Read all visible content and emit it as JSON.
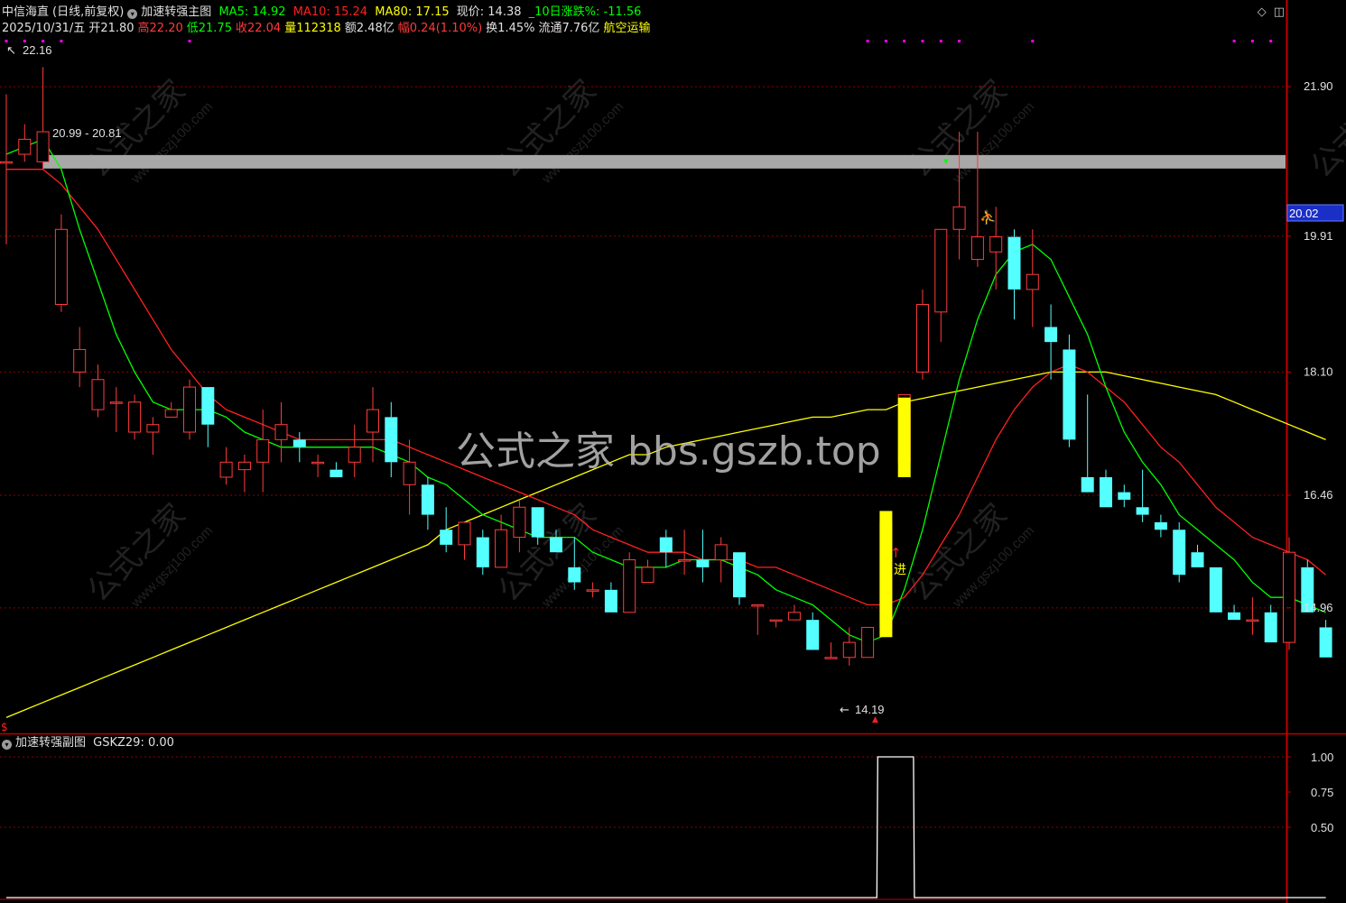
{
  "header": {
    "stock_name": "中信海直",
    "period_mode": "(日线,前复权)",
    "indicator_name": "加速转强主图",
    "ma5": "MA5: 14.92",
    "ma10": "MA10: 15.24",
    "ma80": "MA80: 17.15",
    "current_price": "现价: 14.38",
    "change10": "_10日涨跌%: -11.56",
    "date": "2025/10/31/五",
    "open": "开21.80",
    "high": "高22.20",
    "low": "低21.75",
    "close": "收22.04",
    "volume": "量112318",
    "amount": "额2.48亿",
    "amplitude": "幅0.24(1.10%)",
    "turnover": "换1.45%",
    "float_cap": "流通7.76亿",
    "sector": "航空运输"
  },
  "sub_header": {
    "indicator_name": "加速转强副图",
    "value": "GSKZ29: 0.00"
  },
  "annotations": {
    "high_marker": "22.16",
    "low_marker": "14.19",
    "band_label": "20.99 - 20.81",
    "entry_label": "进",
    "price_tag": "20.02"
  },
  "watermark": {
    "main": "公式之家 bbs.gszb.top",
    "tile_cn": "公式之家",
    "tile_url": "www.gszj100.com"
  },
  "colors": {
    "up": "#ff3b3b",
    "down": "#54ffff",
    "ma5": "#00ff00",
    "ma10": "#ff2020",
    "ma80": "#ffff00",
    "signal": "#ffff00",
    "band": "#a8a8a8",
    "axis": "#c00000",
    "tick_text": "#e0e0e0"
  },
  "chart_data": [
    {
      "type": "candlestick",
      "title": "加速转强主图",
      "y_ticks": [
        "21.90",
        "19.91",
        "18.10",
        "16.46",
        "14.96"
      ],
      "ylim": [
        13.3,
        22.55
      ],
      "ohlc": [
        [
          20.9,
          21.8,
          19.8,
          20.9
        ],
        [
          21.0,
          21.4,
          20.9,
          21.2
        ],
        [
          20.9,
          22.16,
          20.8,
          21.3
        ],
        [
          19.0,
          20.2,
          18.9,
          20.0
        ],
        [
          18.1,
          18.7,
          17.9,
          18.4
        ],
        [
          17.6,
          18.2,
          17.5,
          18.0
        ],
        [
          17.7,
          17.9,
          17.3,
          17.7
        ],
        [
          17.3,
          17.8,
          17.2,
          17.7
        ],
        [
          17.3,
          17.5,
          17.0,
          17.4
        ],
        [
          17.5,
          17.7,
          17.5,
          17.6
        ],
        [
          17.3,
          18.0,
          17.2,
          17.9
        ],
        [
          17.9,
          17.9,
          17.1,
          17.4
        ],
        [
          16.7,
          17.1,
          16.6,
          16.9
        ],
        [
          16.8,
          17.0,
          16.5,
          16.9
        ],
        [
          16.9,
          17.6,
          16.5,
          17.2
        ],
        [
          17.2,
          17.7,
          16.9,
          17.4
        ],
        [
          17.2,
          17.3,
          16.9,
          17.1
        ],
        [
          16.9,
          17.0,
          16.7,
          16.9
        ],
        [
          16.8,
          16.9,
          16.7,
          16.7
        ],
        [
          16.9,
          17.4,
          16.7,
          17.1
        ],
        [
          17.3,
          17.9,
          16.9,
          17.6
        ],
        [
          17.5,
          17.7,
          16.7,
          16.9
        ],
        [
          16.6,
          17.2,
          16.2,
          16.9
        ],
        [
          16.6,
          16.7,
          16.0,
          16.2
        ],
        [
          16.0,
          16.3,
          15.7,
          15.8
        ],
        [
          15.8,
          16.1,
          15.6,
          16.1
        ],
        [
          15.9,
          16.0,
          15.4,
          15.5
        ],
        [
          15.5,
          16.2,
          15.5,
          16.0
        ],
        [
          15.9,
          16.4,
          15.7,
          16.3
        ],
        [
          16.3,
          16.3,
          15.8,
          15.9
        ],
        [
          15.9,
          16.0,
          15.7,
          15.7
        ],
        [
          15.5,
          15.9,
          15.2,
          15.3
        ],
        [
          15.2,
          15.3,
          15.1,
          15.2
        ],
        [
          15.2,
          15.3,
          14.9,
          14.9
        ],
        [
          14.9,
          15.7,
          14.9,
          15.6
        ],
        [
          15.3,
          15.6,
          15.3,
          15.5
        ],
        [
          15.9,
          16.0,
          15.5,
          15.7
        ],
        [
          15.6,
          16.0,
          15.4,
          15.6
        ],
        [
          15.6,
          16.0,
          15.3,
          15.5
        ],
        [
          15.6,
          15.9,
          15.3,
          15.8
        ],
        [
          15.7,
          15.7,
          15.0,
          15.1
        ],
        [
          15.0,
          15.0,
          14.6,
          15.0
        ],
        [
          14.8,
          14.8,
          14.7,
          14.8
        ],
        [
          14.8,
          15.0,
          14.8,
          14.9
        ],
        [
          14.8,
          14.9,
          14.5,
          14.4
        ],
        [
          14.3,
          14.5,
          14.3,
          14.3
        ],
        [
          14.3,
          14.7,
          14.19,
          14.5
        ],
        [
          14.3,
          14.7,
          14.3,
          14.7
        ],
        [
          14.7,
          16.1,
          14.6,
          16.1
        ],
        [
          16.9,
          17.8,
          16.8,
          17.8
        ],
        [
          18.1,
          19.2,
          18.0,
          19.0
        ],
        [
          18.9,
          20.0,
          18.5,
          20.0
        ],
        [
          20.0,
          21.3,
          19.6,
          20.3
        ],
        [
          19.6,
          21.3,
          19.5,
          19.9
        ],
        [
          19.7,
          20.3,
          19.2,
          19.9
        ],
        [
          19.9,
          20.0,
          18.8,
          19.2
        ],
        [
          19.2,
          20.0,
          18.7,
          19.4
        ],
        [
          18.7,
          19.0,
          18.0,
          18.5
        ],
        [
          18.4,
          18.6,
          17.1,
          17.2
        ],
        [
          16.7,
          17.8,
          16.6,
          16.5
        ],
        [
          16.7,
          16.8,
          16.3,
          16.3
        ],
        [
          16.5,
          16.6,
          16.3,
          16.4
        ],
        [
          16.3,
          16.8,
          16.1,
          16.2
        ],
        [
          16.1,
          16.2,
          15.9,
          16.0
        ],
        [
          16.0,
          16.1,
          15.3,
          15.4
        ],
        [
          15.7,
          15.8,
          15.5,
          15.5
        ],
        [
          15.5,
          15.5,
          14.9,
          14.9
        ],
        [
          14.9,
          15.0,
          14.8,
          14.8
        ],
        [
          14.8,
          15.1,
          14.6,
          14.8
        ],
        [
          14.9,
          15.0,
          14.5,
          14.5
        ],
        [
          14.5,
          15.9,
          14.4,
          15.7
        ],
        [
          15.5,
          15.6,
          14.9,
          14.9
        ],
        [
          14.7,
          14.8,
          14.3,
          14.3
        ]
      ],
      "ma5": [
        21.0,
        21.1,
        21.2,
        20.8,
        20.0,
        19.3,
        18.6,
        18.1,
        17.7,
        17.6,
        17.6,
        17.6,
        17.5,
        17.3,
        17.2,
        17.1,
        17.1,
        17.1,
        17.1,
        17.1,
        17.1,
        17.0,
        16.9,
        16.7,
        16.6,
        16.4,
        16.2,
        16.1,
        16.0,
        15.9,
        15.9,
        15.9,
        15.7,
        15.6,
        15.5,
        15.5,
        15.5,
        15.6,
        15.6,
        15.6,
        15.5,
        15.4,
        15.2,
        15.1,
        15.0,
        14.8,
        14.6,
        14.5,
        14.6,
        15.2,
        16.0,
        17.0,
        18.0,
        18.8,
        19.4,
        19.7,
        19.8,
        19.6,
        19.1,
        18.6,
        17.9,
        17.3,
        16.9,
        16.6,
        16.2,
        16.0,
        15.8,
        15.6,
        15.3,
        15.1,
        15.1,
        15.0,
        14.9
      ],
      "ma10": [
        20.8,
        20.8,
        20.8,
        20.6,
        20.3,
        20.0,
        19.6,
        19.2,
        18.8,
        18.4,
        18.1,
        17.8,
        17.6,
        17.5,
        17.4,
        17.3,
        17.2,
        17.2,
        17.2,
        17.2,
        17.2,
        17.2,
        17.1,
        17.0,
        16.9,
        16.8,
        16.7,
        16.6,
        16.5,
        16.4,
        16.3,
        16.2,
        16.0,
        15.9,
        15.8,
        15.7,
        15.7,
        15.7,
        15.6,
        15.6,
        15.6,
        15.5,
        15.5,
        15.4,
        15.3,
        15.2,
        15.1,
        15.0,
        15.0,
        15.1,
        15.4,
        15.8,
        16.2,
        16.7,
        17.2,
        17.6,
        17.9,
        18.1,
        18.2,
        18.1,
        17.9,
        17.7,
        17.4,
        17.1,
        16.9,
        16.6,
        16.3,
        16.1,
        15.9,
        15.8,
        15.7,
        15.6,
        15.4
      ],
      "ma80": [
        13.5,
        13.6,
        13.7,
        13.8,
        13.9,
        14.0,
        14.1,
        14.2,
        14.3,
        14.4,
        14.5,
        14.6,
        14.7,
        14.8,
        14.9,
        15.0,
        15.1,
        15.2,
        15.3,
        15.4,
        15.5,
        15.6,
        15.7,
        15.8,
        16.0,
        16.1,
        16.2,
        16.3,
        16.4,
        16.5,
        16.6,
        16.7,
        16.8,
        16.9,
        17.0,
        17.0,
        17.1,
        17.15,
        17.2,
        17.25,
        17.3,
        17.35,
        17.4,
        17.45,
        17.5,
        17.5,
        17.55,
        17.6,
        17.6,
        17.7,
        17.75,
        17.8,
        17.85,
        17.9,
        17.95,
        18.0,
        18.05,
        18.1,
        18.1,
        18.1,
        18.1,
        18.05,
        18.0,
        17.95,
        17.9,
        17.85,
        17.8,
        17.7,
        17.6,
        17.5,
        17.4,
        17.3,
        17.2
      ],
      "signal_bars": [
        {
          "index": 48,
          "low": 14.57,
          "high": 16.25
        },
        {
          "index": 49,
          "low": 16.7,
          "high": 17.76
        }
      ],
      "resistance_band": {
        "low": 20.81,
        "high": 20.99
      }
    },
    {
      "type": "line",
      "title": "加速转强副图",
      "series": [
        {
          "name": "GSKZ29",
          "values": [
            0,
            0,
            0,
            0,
            0,
            0,
            0,
            0,
            0,
            0,
            0,
            0,
            0,
            0,
            0,
            0,
            0,
            0,
            0,
            0,
            0,
            0,
            0,
            0,
            0,
            0,
            0,
            0,
            0,
            0,
            0,
            0,
            0,
            0,
            0,
            0,
            0,
            0,
            0,
            0,
            0,
            0,
            0,
            0,
            0,
            0,
            0,
            0,
            1,
            1,
            0,
            0,
            0,
            0,
            0,
            0,
            0,
            0,
            0,
            0,
            0,
            0,
            0,
            0,
            0,
            0,
            0,
            0,
            0,
            0,
            0,
            0,
            0
          ]
        }
      ],
      "y_ticks": [
        "1.00",
        "0.75",
        "0.50"
      ],
      "ylim": [
        0,
        1
      ]
    }
  ]
}
